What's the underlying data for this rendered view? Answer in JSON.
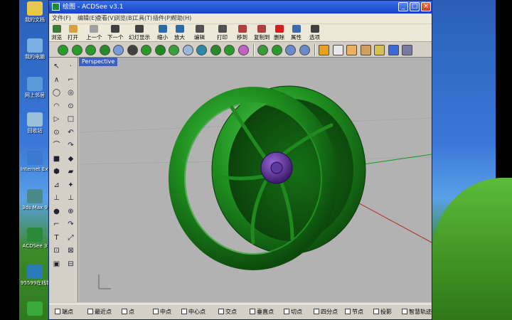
{
  "desktop": {
    "icons": [
      {
        "label": "我的文档",
        "color": "#e8c84a"
      },
      {
        "label": "我的电脑",
        "color": "#7ab0e0"
      },
      {
        "label": "网上邻居",
        "color": "#5a9ad8"
      },
      {
        "label": "回收站",
        "color": "#9ac0d8"
      },
      {
        "label": "Internet Explorer",
        "color": "#3a7ad0"
      },
      {
        "label": "3ds Max 9",
        "color": "#4a8a8a"
      },
      {
        "label": "ACDSee 3",
        "color": "#2a8a3a"
      },
      {
        "label": "95599在线银行",
        "color": "#2a7ab8"
      },
      {
        "label": "",
        "color": "#3aa83a"
      }
    ]
  },
  "window": {
    "title": "绘图 - ACDSee v3.1",
    "menus": [
      "文件(F)",
      "编辑(E)",
      "查看(V)",
      "浏览(B)",
      "工具(T)",
      "插件(P)",
      "帮助(H)"
    ],
    "toolbar": [
      {
        "label": "浏览",
        "color": "#3a7a3a"
      },
      {
        "label": "打开",
        "color": "#d8a040"
      },
      {
        "label": "上一个",
        "color": "#a0a0a0"
      },
      {
        "label": "下一个",
        "color": "#404040"
      },
      {
        "label": "幻灯显示",
        "color": "#404040"
      },
      {
        "label": "缩小",
        "color": "#2a6aa8"
      },
      {
        "label": "放大",
        "color": "#2a6aa8"
      },
      {
        "label": "编辑",
        "color": "#505050"
      },
      {
        "label": "打印",
        "color": "#505050"
      },
      {
        "label": "移到",
        "color": "#b04040"
      },
      {
        "label": "复制到",
        "color": "#b04040"
      },
      {
        "label": "删除",
        "color": "#d02020"
      },
      {
        "label": "属性",
        "color": "#3a6ab0"
      },
      {
        "label": "选项",
        "color": "#404040"
      }
    ],
    "render_toolbar_colors": [
      "#2a9a2a",
      "#2a9a2a",
      "#2a9a2a",
      "#2a8a2a",
      "#7a9ad8",
      "#404040",
      "#2a9a2a",
      "#208a20",
      "#3aa03a",
      "#9ab8d8",
      "#2a8aa8",
      "#2a8a2a",
      "#2a9a2a",
      "#c060c0",
      "#3a9a3a",
      "#2a9a2a",
      "#6a8ac8",
      "#6a8ac8",
      "#e8a020",
      "#e8e8e8",
      "#e8b060",
      "#d0a060",
      "#d8c050",
      "#3a6ad8",
      "#7a7aa0"
    ],
    "viewport": {
      "label": "Perspective",
      "model": "green wheel rim with purple hub"
    },
    "snaps": [
      "端点",
      "最近点",
      "点",
      "中点",
      "中心点",
      "交点",
      "垂直点",
      "切点",
      "四分点",
      "节点",
      "投影",
      "智慧轨迹"
    ]
  }
}
